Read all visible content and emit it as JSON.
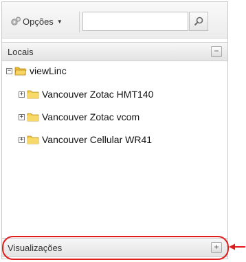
{
  "toolbar": {
    "options_label": "Opções",
    "options_icon": "gear-icon",
    "caret_icon": "caret-down-icon",
    "search_value": "",
    "search_icon": "magnifier-icon"
  },
  "locais": {
    "title": "Locais",
    "toggle_symbol": "−"
  },
  "tree": {
    "root": {
      "label": "viewLinc",
      "expanded": true,
      "expander_symbol": "−"
    },
    "children": [
      {
        "label": "Vancouver Zotac HMT140",
        "expander_symbol": "+"
      },
      {
        "label": "Vancouver Zotac vcom",
        "expander_symbol": "+"
      },
      {
        "label": "Vancouver Cellular WR41",
        "expander_symbol": "+"
      }
    ]
  },
  "visualizacoes": {
    "title": "Visualizações",
    "toggle_symbol": "+"
  },
  "colors": {
    "highlight": "#e21b1b",
    "folder": "#f3cc4b"
  }
}
